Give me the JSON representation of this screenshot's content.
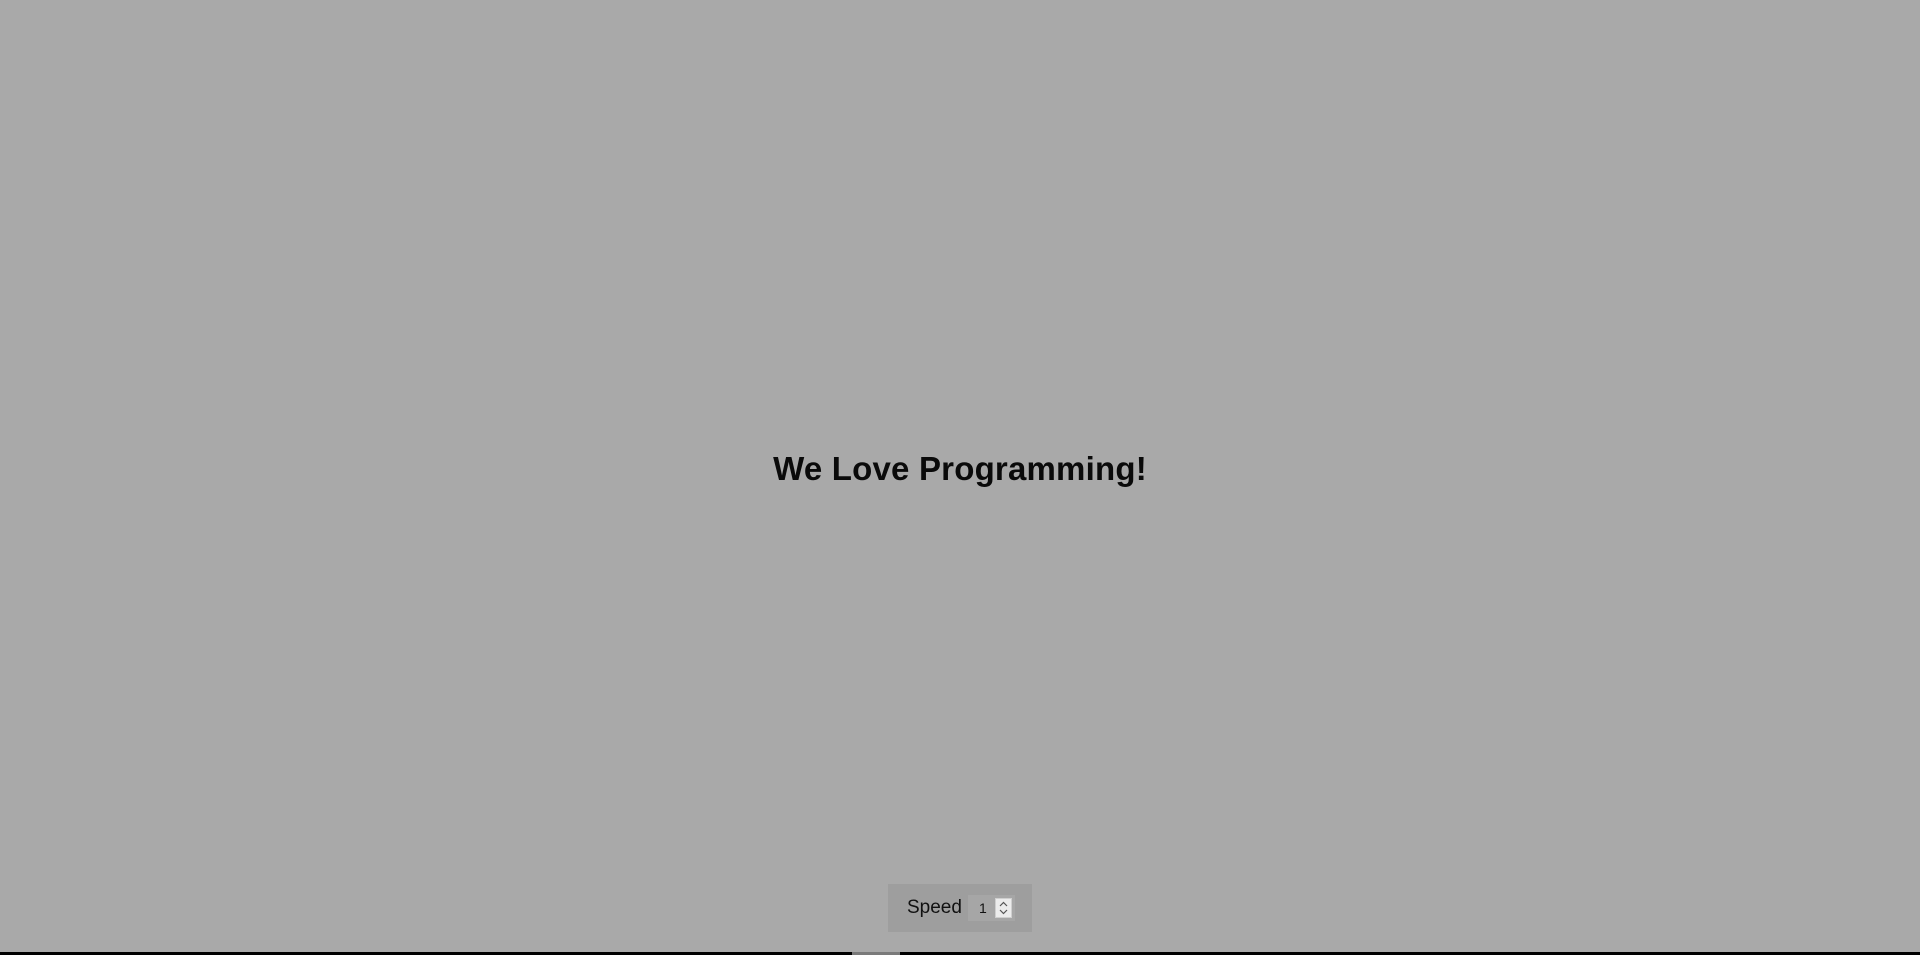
{
  "headline": "We Love Programming!",
  "speed": {
    "label": "Speed",
    "value": "1"
  },
  "icons": {
    "stepper_up": "chevron-up-icon",
    "stepper_down": "chevron-down-icon"
  },
  "colors": {
    "background": "#a9a9a9",
    "panel": "#9e9e9e",
    "text": "#0a0a0a"
  }
}
